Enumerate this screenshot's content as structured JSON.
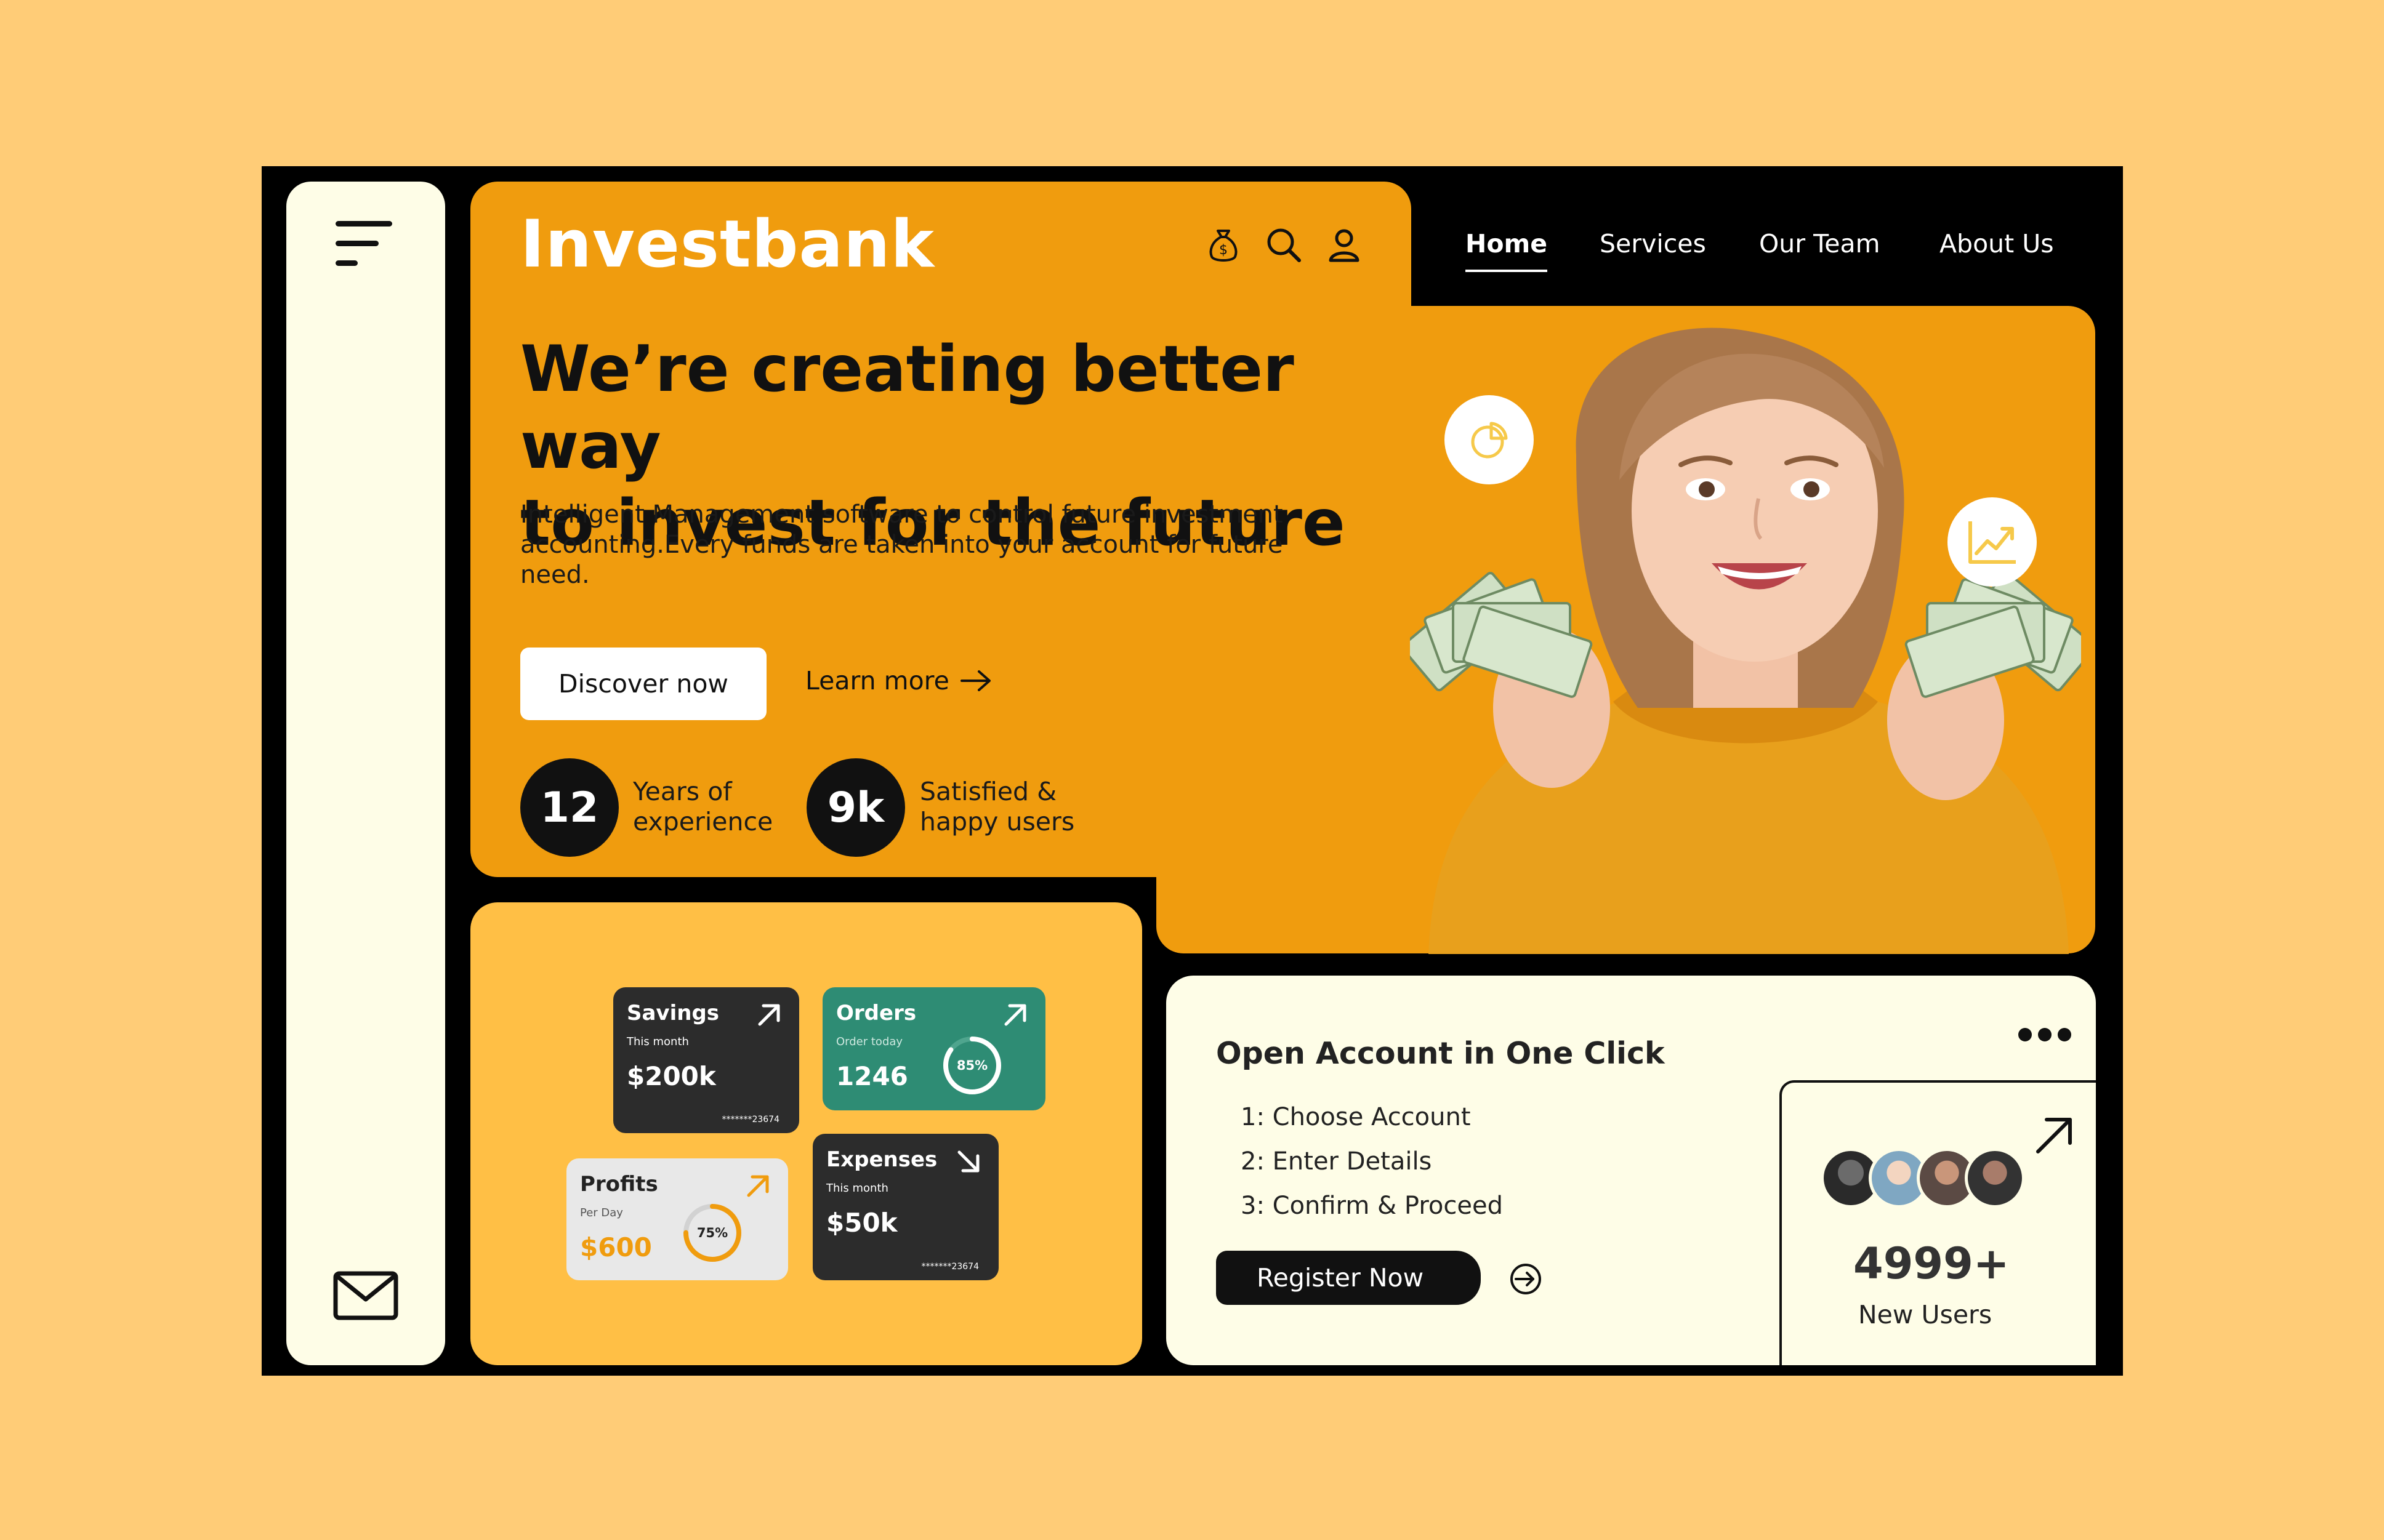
{
  "brand": "Investbank",
  "nav": {
    "home": "Home",
    "services": "Services",
    "team": "Our Team",
    "about": "About Us"
  },
  "hero": {
    "headline_line1": "We’re creating better way",
    "headline_line2": "to invest for the future",
    "subtext": "Intelligent Management software to control future investment accounting.Every funds are taken into your account for future need.",
    "discover_label": "Discover now",
    "learn_label": "Learn more",
    "stats": [
      {
        "value": "12",
        "label_line1": "Years of",
        "label_line2": "experience"
      },
      {
        "value": "9k",
        "label_line1": "Satisfied &",
        "label_line2": "happy users"
      }
    ]
  },
  "cards": {
    "savings": {
      "title": "Savings",
      "sub": "This month",
      "value": "$200k",
      "code": "*******23674"
    },
    "orders": {
      "title": "Orders",
      "sub": "Order today",
      "value": "1246",
      "percent_label": "85%",
      "percent": 0.85
    },
    "profits": {
      "title": "Profits",
      "sub": "Per Day",
      "value": "$600",
      "percent_label": "75%",
      "percent": 0.75
    },
    "expenses": {
      "title": "Expenses",
      "sub": "This month",
      "value": "$50k",
      "code": "*******23674"
    }
  },
  "account": {
    "title": "Open Account in One Click",
    "steps": [
      "1: Choose Account",
      "2: Enter Details",
      "3: Confirm & Proceed"
    ],
    "register_label": "Register Now",
    "users_count": "4999+",
    "users_label": "New Users"
  },
  "colors": {
    "page_bg": "#FFCC77",
    "frame": "#000000",
    "hero_orange": "#F09C0E",
    "dash_yellow": "#FFBF45",
    "cream": "#FEFDE7",
    "teal": "#2E8C74",
    "card_dark": "#2C2C2C"
  }
}
